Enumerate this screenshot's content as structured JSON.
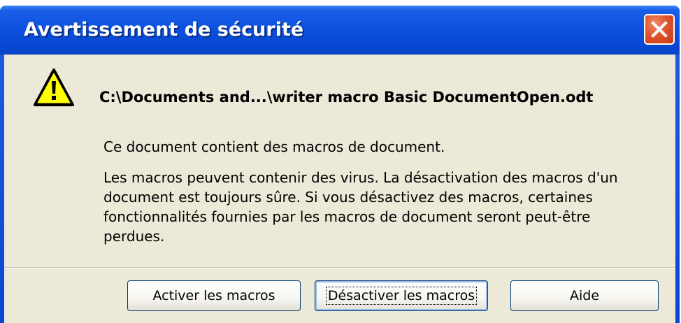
{
  "dialog": {
    "title": "Avertissement de sécurité",
    "file_path": "C:\\Documents and...\\writer macro Basic DocumentOpen.odt",
    "message_intro": "Ce document contient des macros de document.",
    "message_body_lines": [
      "Les macros peuvent contenir des virus. La désactivation des macros d'un",
      "document est toujours sûre. Si vous désactivez des macros, certaines",
      "fonctionnalités fournies par les macros de document seront peut-être",
      "perdues."
    ],
    "buttons": {
      "enable": "Activer les macros",
      "disable": "Désactiver les macros",
      "help": "Aide"
    },
    "icons": {
      "warning": "warning-icon",
      "close": "close-icon"
    },
    "colors": {
      "titlebar": "#0a4fdc",
      "close": "#e0552e",
      "client": "#ece9d8"
    }
  }
}
